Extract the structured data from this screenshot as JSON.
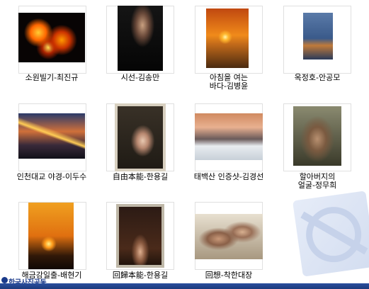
{
  "items": [
    {
      "label": "소원빌기-최진규",
      "thumb": "night festival fire"
    },
    {
      "label": "시선-김송만",
      "thumb": "dancer dark"
    },
    {
      "label": "아침을 여는\n바다-김병윤",
      "thumb": "sunrise sea"
    },
    {
      "label": "옥정호-안공모",
      "thumb": "lake blue"
    },
    {
      "label": "인천대교 야경-이두수",
      "thumb": "bridge night"
    },
    {
      "label": "自由本能-한용길",
      "thumb": "figure frame"
    },
    {
      "label": "태백산 인증샷-김경선",
      "thumb": "snow mountain"
    },
    {
      "label": "할아버지의\n얼굴-정무희",
      "thumb": "old man face"
    },
    {
      "label": "해금강일출-배현기",
      "thumb": "sunrise rock"
    },
    {
      "label": "回歸本能-한용길",
      "thumb": "figure box"
    },
    {
      "label": "回想-착한대장",
      "thumb": "two elders"
    }
  ],
  "footer": {
    "text": "한국사진공동"
  }
}
